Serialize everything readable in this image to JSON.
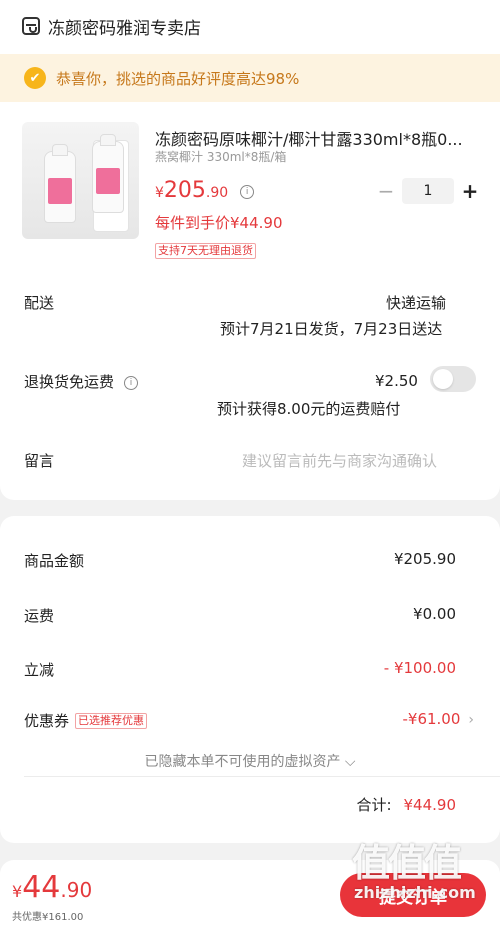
{
  "shop": {
    "icon": "store-icon",
    "name": "冻颜密码雅润专卖店"
  },
  "banner": {
    "icon": "thumbs-up-icon",
    "text": "恭喜你，挑选的商品好评度高达98%",
    "color": "#c6781b",
    "background": "#fdf3e0"
  },
  "product": {
    "title": "冻颜密码原味椰汁/椰汁甘露330ml*8瓶0...",
    "spec": "燕窝椰汁 330ml*8瓶/箱",
    "price_currency": "¥",
    "price_int": "205",
    "price_dec": ".90",
    "unit_price": "每件到手价¥44.90",
    "return_tag": "支持7天无理由退货",
    "quantity": "1",
    "minus": "−",
    "plus": "+"
  },
  "delivery": {
    "label": "配送",
    "type": "快递运输",
    "eta": "预计7月21日发货，7月23日送达"
  },
  "return_fee": {
    "label": "退换货免运费",
    "amount": "¥2.50",
    "note": "预计获得8.00元的运费赔付",
    "enabled": false
  },
  "message": {
    "label": "留言",
    "placeholder": "建议留言前先与商家沟通确认"
  },
  "summary": {
    "goods_label": "商品金额",
    "goods_value": "¥205.90",
    "shipping_label": "运费",
    "shipping_value": "¥0.00",
    "instant_label": "立减",
    "instant_value": "- ¥100.00",
    "coupon_label": "优惠券",
    "coupon_tag": "已选推荐优惠",
    "coupon_value": "-¥61.00",
    "hidden_assets": "已隐藏本单不可使用的虚拟资产 ⌵",
    "total_label": "合计:",
    "total_value": "¥44.90"
  },
  "bottom": {
    "currency": "¥",
    "price_int": "44",
    "price_dec": ".90",
    "discount": "共优惠¥161.00",
    "submit": "提交订单"
  },
  "watermark": {
    "chars": "值值值",
    "url": "zhizhizhi.com"
  },
  "colors": {
    "accent": "#e4393c",
    "button": "#e8343a"
  }
}
